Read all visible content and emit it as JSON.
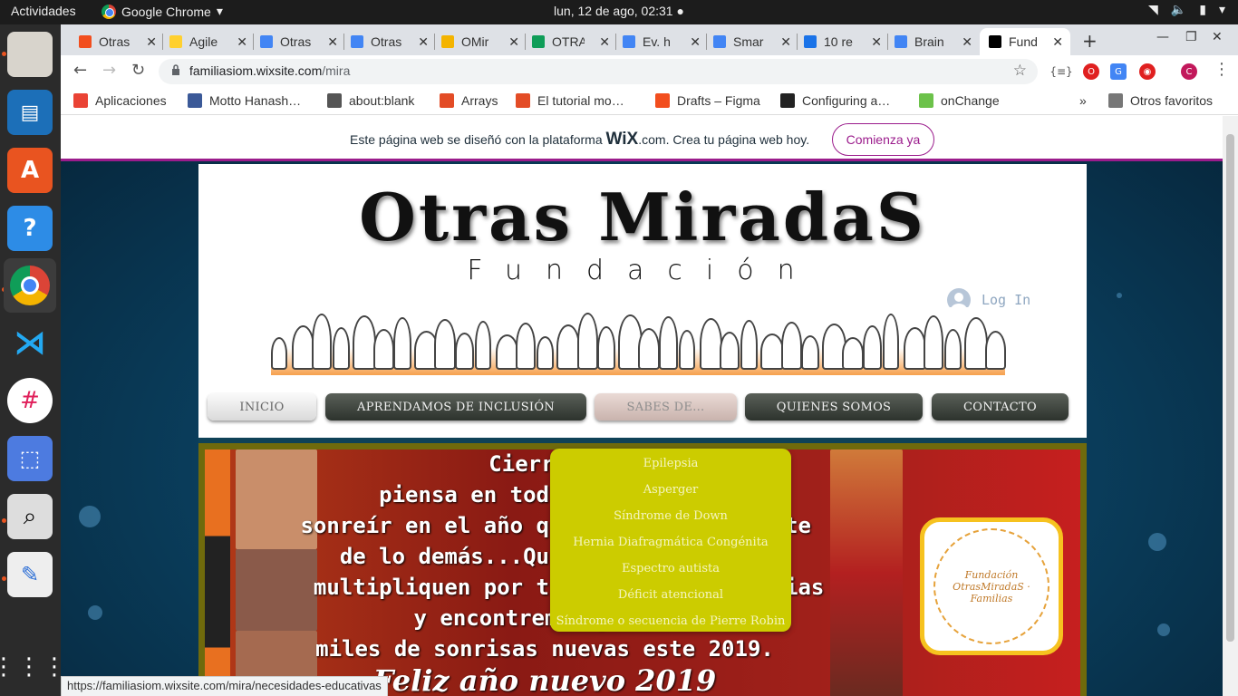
{
  "topbar": {
    "activities": "Actividades",
    "app_name": "Google Chrome",
    "clock": "lun, 12 de ago, 02:31"
  },
  "tabs": [
    {
      "label": "Otras",
      "icon": "figma-icon",
      "color": "#f24e1e"
    },
    {
      "label": "Agile",
      "icon": "miro-icon",
      "color": "#ffd02f"
    },
    {
      "label": "Otras",
      "icon": "docs-icon",
      "color": "#4285f4"
    },
    {
      "label": "Otras",
      "icon": "docs-icon",
      "color": "#4285f4"
    },
    {
      "label": "OMir",
      "icon": "slides-icon",
      "color": "#f4b400"
    },
    {
      "label": "OTRA",
      "icon": "drive-icon",
      "color": "#0f9d58"
    },
    {
      "label": "Ev. h",
      "icon": "docs-icon",
      "color": "#4285f4"
    },
    {
      "label": "Smar",
      "icon": "docs-icon",
      "color": "#4285f4"
    },
    {
      "label": "10 re",
      "icon": "star-icon",
      "color": "#1a73e8"
    },
    {
      "label": "Brain",
      "icon": "docs-icon",
      "color": "#4285f4"
    },
    {
      "label": "Fund",
      "icon": "wix-icon",
      "color": "#000000"
    }
  ],
  "omnibox": {
    "domain": "familiasiom.wixsite.com",
    "path": "/mira"
  },
  "bookmarks": [
    {
      "label": "Aplicaciones",
      "icon": "apps-grid-icon",
      "color": "#ea4335"
    },
    {
      "label": "Motto Hanash…",
      "icon": "facebook-icon",
      "color": "#3b5998"
    },
    {
      "label": "about:blank",
      "icon": "globe-icon",
      "color": "#555555"
    },
    {
      "label": "Arrays",
      "icon": "js-icon",
      "color": "#e34c26"
    },
    {
      "label": "El tutorial mo…",
      "icon": "js-icon",
      "color": "#e34c26"
    },
    {
      "label": "Drafts – Figma",
      "icon": "figma-icon",
      "color": "#f24e1e"
    },
    {
      "label": "Configuring a…",
      "icon": "github-icon",
      "color": "#222222"
    },
    {
      "label": "onChange",
      "icon": "code-icon",
      "color": "#6cc24a"
    }
  ],
  "bookmarks_more": "»",
  "bookmarks_other": "Otros favoritos",
  "wixbar": {
    "message_pre": "Este página web se diseñó con la plataforma",
    "brand": "WiX",
    "message_post": ".com. Crea tu página web hoy.",
    "cta": "Comienza ya"
  },
  "site": {
    "title": "Otras MiradaS",
    "subtitle": "Fundación",
    "login": "Log In",
    "nav": [
      "INICIO",
      "APRENDAMOS DE INCLUSIÓN",
      "SABES DE...",
      "QUIENES SOMOS",
      "CONTACTO"
    ],
    "dropdown": [
      "Epilepsia",
      "Asperger",
      "Síndrome de Down",
      "Hernia Diafragmática Congénita",
      "Espectro autista",
      "Déficit atencional",
      "Síndrome o secuencia de Pierre Robin"
    ],
    "hero_lines": [
      "Cierra",
      "piensa en tod",
      "sonreír en el año q",
      "te",
      "de lo demás...Qu",
      "multipliquen por t",
      "ias",
      "y encontremos juntos",
      "miles de sonrisas nuevas este 2019.",
      "Feliz año nuevo 2019"
    ],
    "hero_logo": "Fundación OtrasMiradaS · Familias"
  },
  "status_url": "https://familiasiom.wixsite.com/mira/necesidades-educativas"
}
